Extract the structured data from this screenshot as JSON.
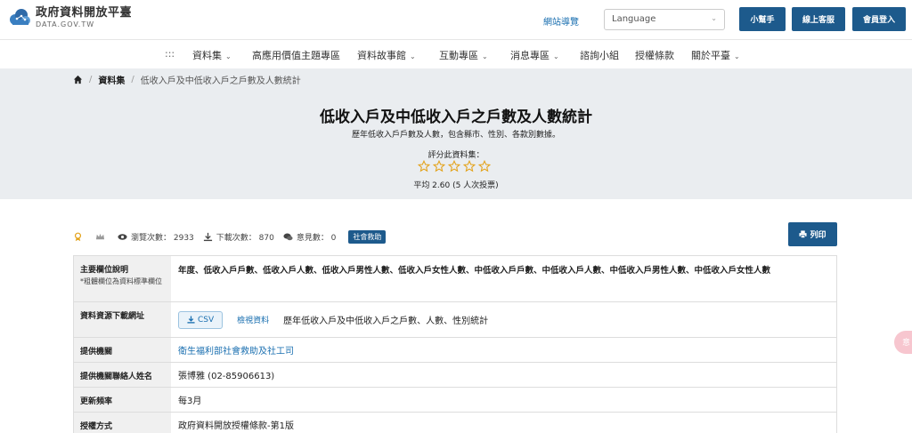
{
  "header": {
    "logo_title": "政府資料開放平臺",
    "logo_sub": "DATA.GOV.TW",
    "sitemap": "網站導覽",
    "language_placeholder": "Language",
    "buttons": [
      "小幫手",
      "線上客服",
      "會員登入"
    ]
  },
  "nav": {
    "menu_glyph": ":::",
    "items": [
      {
        "label": "資料集",
        "dropdown": true
      },
      {
        "label": "高應用價值主題專區",
        "dropdown": false
      },
      {
        "label": "資料故事館",
        "dropdown": true
      },
      {
        "label": "互動專區",
        "dropdown": true
      },
      {
        "label": "消息專區",
        "dropdown": true
      },
      {
        "label": "諮詢小組",
        "dropdown": false
      },
      {
        "label": "授權條款",
        "dropdown": false
      },
      {
        "label": "關於平臺",
        "dropdown": true
      }
    ]
  },
  "breadcrumb": {
    "section": "資料集",
    "current": "低收入戶及中低收入戶之戶數及人數統計"
  },
  "dataset": {
    "title": "低收入戶及中低收入戶之戶數及人數統計",
    "description": "歷年低收入戶戶數及人數，包含縣市、性別、各款別數據。",
    "rate_label": "評分此資料集：",
    "stars": 5,
    "average": "平均 2.60 (5 人次投票)"
  },
  "stats": {
    "views": "瀏覽次數： 2933",
    "downloads": "下載次數： 870",
    "comments": "意見數： 0",
    "tag": "社會救助",
    "print": "列印"
  },
  "table": {
    "fields_header": "主要欄位說明",
    "fields_note": "*粗體欄位為資料標準欄位",
    "fields_value": "年度、低收入戶戶數、低收入戶人數、低收入戶男性人數、低收入戶女性人數、中低收入戶戶數、中低收入戶人數、中低收入戶男性人數、中低收入戶女性人數",
    "download_header": "資料資源下載網址",
    "csv_label": "CSV",
    "preview_label": "檢視資料",
    "download_desc": "歷年低收入戶及中低收入戶之戶數、人數、性別統計",
    "provider_header": "提供機關",
    "provider_value": "衛生福利部社會救助及社工司",
    "contact_header": "提供機關聯絡人姓名",
    "contact_value": "張博雅 (02-85906613)",
    "frequency_header": "更新頻率",
    "frequency_value": "每3月",
    "license_header": "授權方式",
    "license_value": "政府資料開放授權條款-第1版"
  },
  "float_tab": "意",
  "colors": {
    "primary": "#1d5a8c",
    "link": "#1a6fb0",
    "hero_bg": "#eaedf0",
    "star": "#e3a21a"
  }
}
